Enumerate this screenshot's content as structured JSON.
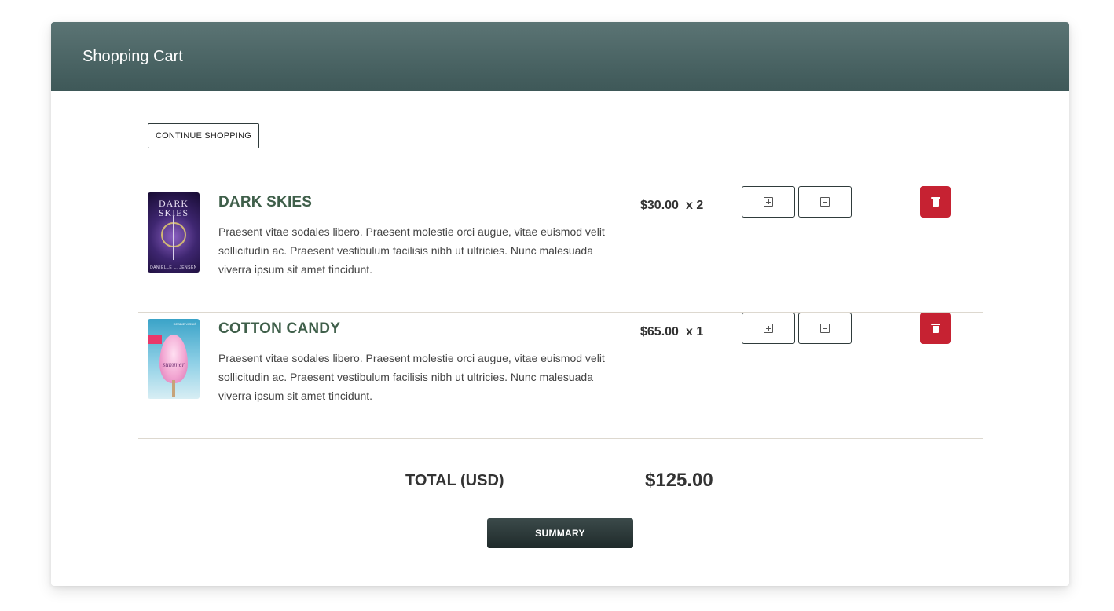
{
  "header": {
    "title": "Shopping Cart"
  },
  "actions": {
    "continue_label": "CONTINUE SHOPPING",
    "summary_label": "SUMMARY"
  },
  "items": [
    {
      "name": "DARK SKIES",
      "description": "Praesent vitae sodales libero. Praesent molestie orci augue, vitae euismod velit sollicitudin ac. Praesent vestibulum facilisis nibh ut ultricies. Nunc malesuada viverra ipsum sit amet tincidunt.",
      "price": "$30.00",
      "quantity": "x 2",
      "cover": {
        "title": "DARK SKIES",
        "author": "DANIELLE L. JENSEN"
      }
    },
    {
      "name": "COTTON CANDY",
      "description": "Praesent vitae sodales libero. Praesent molestie orci augue, vitae euismod velit sollicitudin ac. Praesent vestibulum facilisis nibh ut ultricies. Nunc malesuada viverra ipsum sit amet tincidunt.",
      "price": "$65.00",
      "quantity": "x 1",
      "cover": {
        "title": "summer",
        "author": "DEBBIE VIGUIÉ"
      }
    }
  ],
  "total": {
    "label": "TOTAL (USD)",
    "value": "$125.00"
  },
  "icons": {
    "increase": "plus-square-icon",
    "decrease": "minus-square-icon",
    "remove": "trash-icon"
  },
  "colors": {
    "header": "#4a6565",
    "title": "#3f5f4a",
    "delete": "#c62232",
    "summary": "#2a3636"
  }
}
